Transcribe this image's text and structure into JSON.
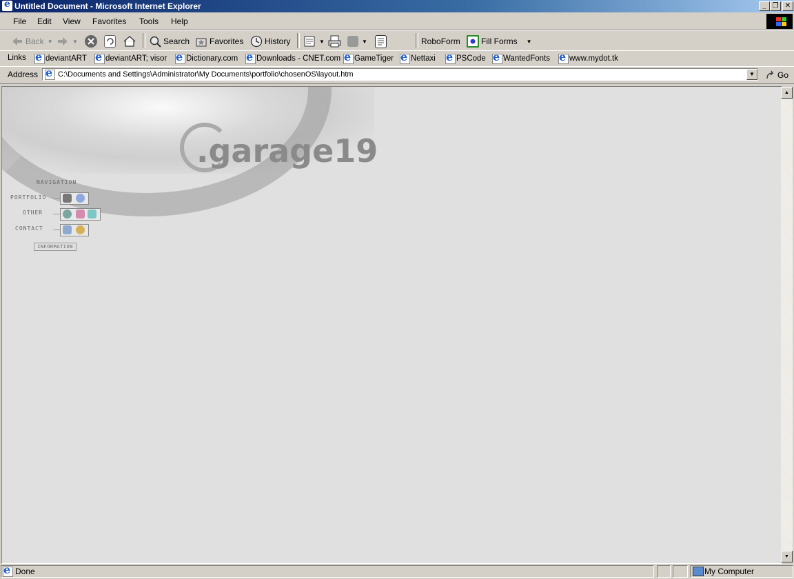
{
  "window": {
    "title": "Untitled Document - Microsoft Internet Explorer"
  },
  "menubar": {
    "items": [
      {
        "label": "File"
      },
      {
        "label": "Edit"
      },
      {
        "label": "View"
      },
      {
        "label": "Favorites"
      },
      {
        "label": "Tools"
      },
      {
        "label": "Help"
      }
    ]
  },
  "toolbar": {
    "back_label": "Back",
    "search_label": "Search",
    "favorites_label": "Favorites",
    "history_label": "History",
    "roboform_label": "RoboForm",
    "fillforms_label": "Fill Forms"
  },
  "links": {
    "title": "Links",
    "items": [
      {
        "label": "deviantART"
      },
      {
        "label": "deviantART; visor"
      },
      {
        "label": "Dictionary.com"
      },
      {
        "label": "Downloads - CNET.com"
      },
      {
        "label": "GameTiger"
      },
      {
        "label": "Nettaxi"
      },
      {
        "label": "PSCode"
      },
      {
        "label": "WantedFonts"
      },
      {
        "label": "www.mydot.tk"
      }
    ]
  },
  "address": {
    "label": "Address",
    "value": "C:\\Documents and Settings\\Administrator\\My Documents\\portfolio\\chosenOS\\layout.htm",
    "go_label": "Go"
  },
  "page": {
    "logo_text": ".garage19",
    "nav_title": "NAVIGATION",
    "nav_rows": [
      {
        "label": "PORTFOLIO"
      },
      {
        "label": "OTHER"
      },
      {
        "label": "CONTACT"
      }
    ],
    "info_label": "INFORMATION"
  },
  "status": {
    "text": "Done",
    "zone": "My Computer"
  },
  "colors": {
    "titlebar_start": "#0a246a",
    "titlebar_end": "#a6caf0",
    "chrome": "#d4d0c8",
    "page_bg": "#e0e0e0"
  }
}
